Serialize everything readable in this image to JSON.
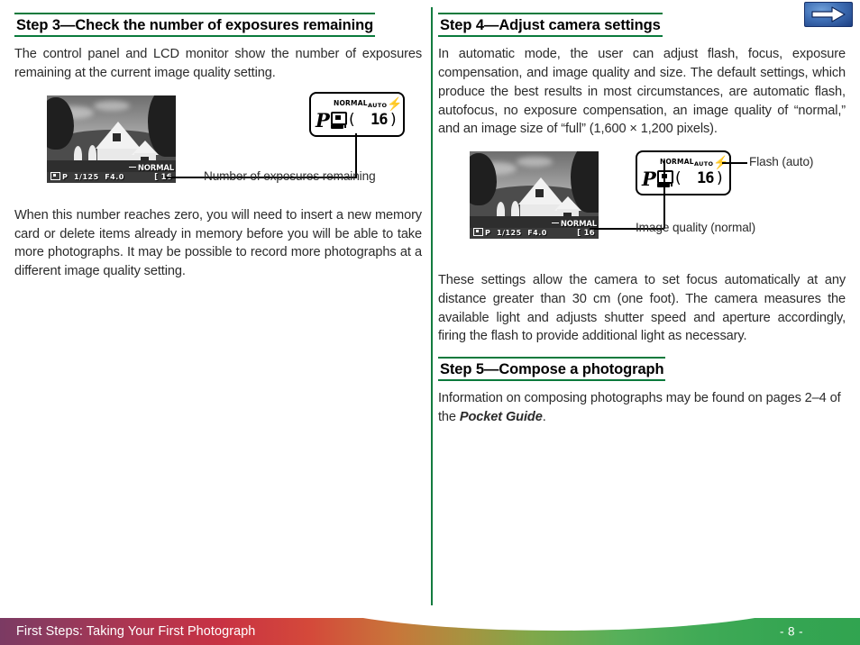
{
  "document": {
    "left_column": {
      "heading": "Step 3—Check the number of exposures remaining",
      "paragraph_1": "The control panel and LCD monitor show the number of exposures remaining at the current image quality setting.",
      "paragraph_2": "When this number reaches zero, you will need to insert a new memory card or delete items already in memory before you will be able to take more photographs.  It may be possible to record more photographs at a different image quality setting.",
      "callout": "Number of exposures remaining"
    },
    "right_column": {
      "heading_step4": "Step 4—Adjust camera settings",
      "paragraph_1": "In automatic mode, the user can adjust flash, focus, exposure compensation, and image quality and size.  The default settings, which produce the best results in most circumstances, are automatic flash, autofocus, no exposure compensation, an image quality of “normal,” and an image size of “full” (1,600 × 1,200 pixels).",
      "paragraph_2": "These settings allow the camera to set focus automatically at any distance greater than 30 cm (one foot).  The camera measures the available light and adjusts shutter speed and aperture accordingly, firing the flash to provide additional light as necessary.",
      "heading_step5": "Step 5—Compose a photograph",
      "paragraph_3_before_italic": "Information on composing photographs may be found on pages 2–4 of the ",
      "paragraph_3_italic": "Pocket Guide",
      "paragraph_3_after_italic": ".",
      "callout_flash": "Flash (auto)",
      "callout_quality": "Image quality (normal)"
    }
  },
  "lcd_monitor": {
    "osd_mode": "P",
    "osd_shutter": "1/125",
    "osd_aperture": "F4.0",
    "osd_quality": "NORMAL",
    "osd_remaining": "[  16"
  },
  "control_panel": {
    "quality": "NORMAL",
    "flash_mode": "AUTO",
    "flash_icon": "lightning-bolt-icon",
    "exposure_mode": "P",
    "af_icon": "autofocus-area-icon",
    "battery_icon": "battery-icon",
    "frames_open_paren": "(",
    "frames_value": "16",
    "frames_close_paren": ")"
  },
  "footer": {
    "title": "First Steps: Taking Your First Photograph",
    "page_label": "- 8 -",
    "next_icon": "right-arrow-icon"
  },
  "colors": {
    "heading_rule": "#0a7a3c",
    "divider": "#137b3f",
    "footer_start": "#7b3a63",
    "footer_mid": "#c93243",
    "footer_end": "#31a450",
    "next_button": "#3f6fb5"
  }
}
